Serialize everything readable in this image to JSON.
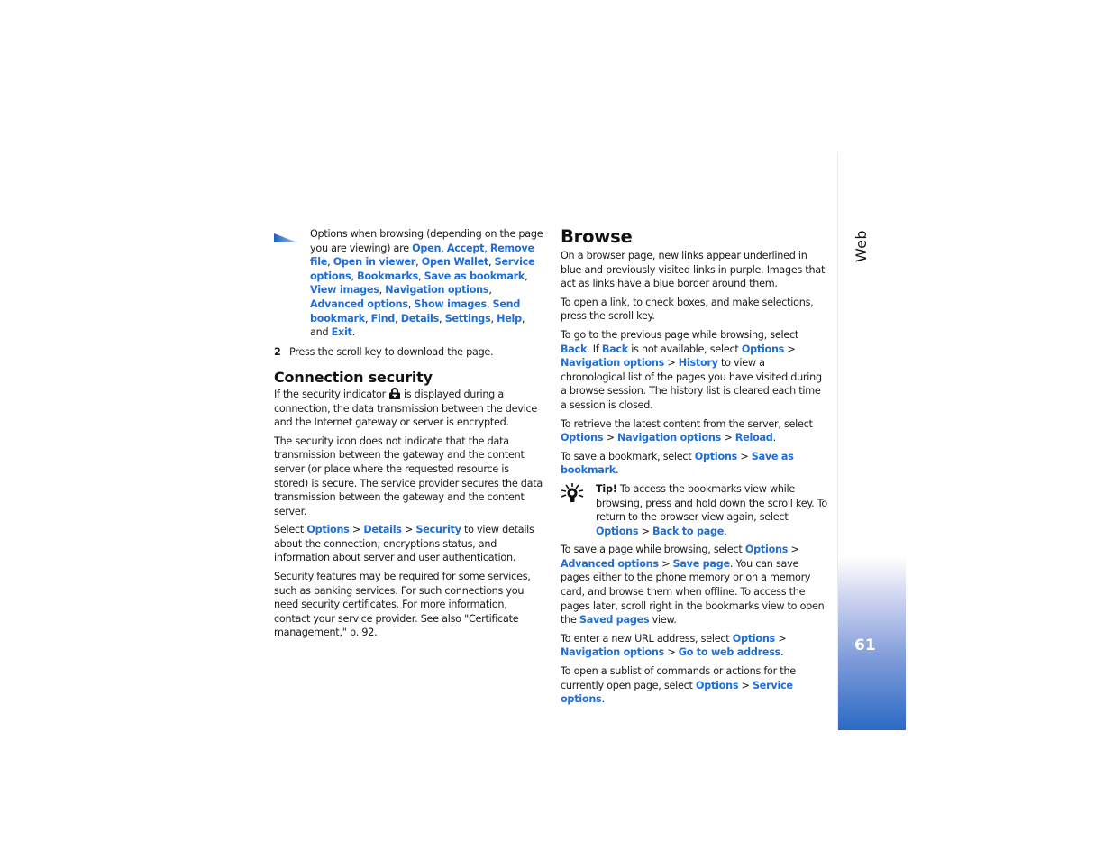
{
  "left": {
    "note": {
      "intro": "Options when browsing (depending on the page you are viewing) are ",
      "options": [
        "Open",
        "Accept",
        "Remove file",
        "Open in viewer",
        "Open Wallet",
        "Service options",
        "Bookmarks",
        "Save as bookmark",
        "View images",
        "Navigation options",
        "Advanced options",
        "Show images",
        "Send bookmark",
        "Find",
        "Details",
        "Settings",
        "Help"
      ],
      "and": ", and ",
      "last": "Exit",
      "end": "."
    },
    "step": {
      "number": "2",
      "text": "Press the scroll key to download the page."
    },
    "section": {
      "title": "Connection security",
      "p1_a": "If the security indicator",
      "p1_b": "is displayed during a connection, the data transmission between the device and the Internet gateway or server is encrypted.",
      "p2": "The security icon does not indicate that the data transmission between the gateway and the content server (or place where the requested resource is stored) is secure. The service provider secures the data transmission between the gateway and the content server.",
      "p3_a": "Select ",
      "p3_links": [
        "Options",
        "Details",
        "Security"
      ],
      "p3_b": " to view details about the connection, encryptions status, and information about server and user authentication.",
      "p4": "Security features may be required for some services, such as banking services. For such connections you need security certificates. For more information, contact your service provider. See also \"Certificate management,\" p. 92."
    }
  },
  "right": {
    "title": "Browse",
    "p1": "On a browser page, new links appear underlined in blue and previously visited links in purple. Images that act as links have a blue border around them.",
    "p2": "To open a link, to check boxes, and make selections, press the scroll key.",
    "p3": {
      "a": "To go to the previous page while browsing, select ",
      "back1": "Back",
      "b": ". If ",
      "back2": "Back",
      "c": " is not available, select ",
      "links": [
        "Options",
        "Navigation options",
        "History"
      ],
      "d": " to view a chronological list of the pages you have visited during a browse session. The history list is cleared each time a session is closed."
    },
    "p4": {
      "a": "To retrieve the latest content from the server, select ",
      "links": [
        "Options",
        "Navigation options",
        "Reload"
      ],
      "end": "."
    },
    "p5": {
      "a": "To save a bookmark, select ",
      "links": [
        "Options",
        "Save as bookmark"
      ],
      "end": "."
    },
    "tip": {
      "label": "Tip!",
      "a": " To access the bookmarks view while browsing, press and hold down the scroll key. To return to the browser view again, select ",
      "links": [
        "Options",
        "Back to page"
      ],
      "end": "."
    },
    "p6": {
      "a": "To save a page while browsing, select ",
      "links": [
        "Options",
        "Advanced options",
        "Save page"
      ],
      "b": ". You can save pages either to the phone memory or on a memory card, and browse them when offline. To access the pages later, scroll right in the bookmarks view to open the ",
      "saved": "Saved pages",
      "c": " view."
    },
    "p7": {
      "a": "To enter a new URL address, select ",
      "links": [
        "Options",
        "Navigation options",
        "Go to web address"
      ],
      "end": "."
    },
    "p8": {
      "a": "To open a sublist of commands or actions for the currently open page, select ",
      "links": [
        "Options",
        "Service options"
      ],
      "end": "."
    }
  },
  "sidebar": {
    "section": "Web",
    "page_number": "61"
  },
  "separator": " > ",
  "colors": {
    "link": "#1f6fd6",
    "tab_gradient_end": "#2a6ac4"
  }
}
